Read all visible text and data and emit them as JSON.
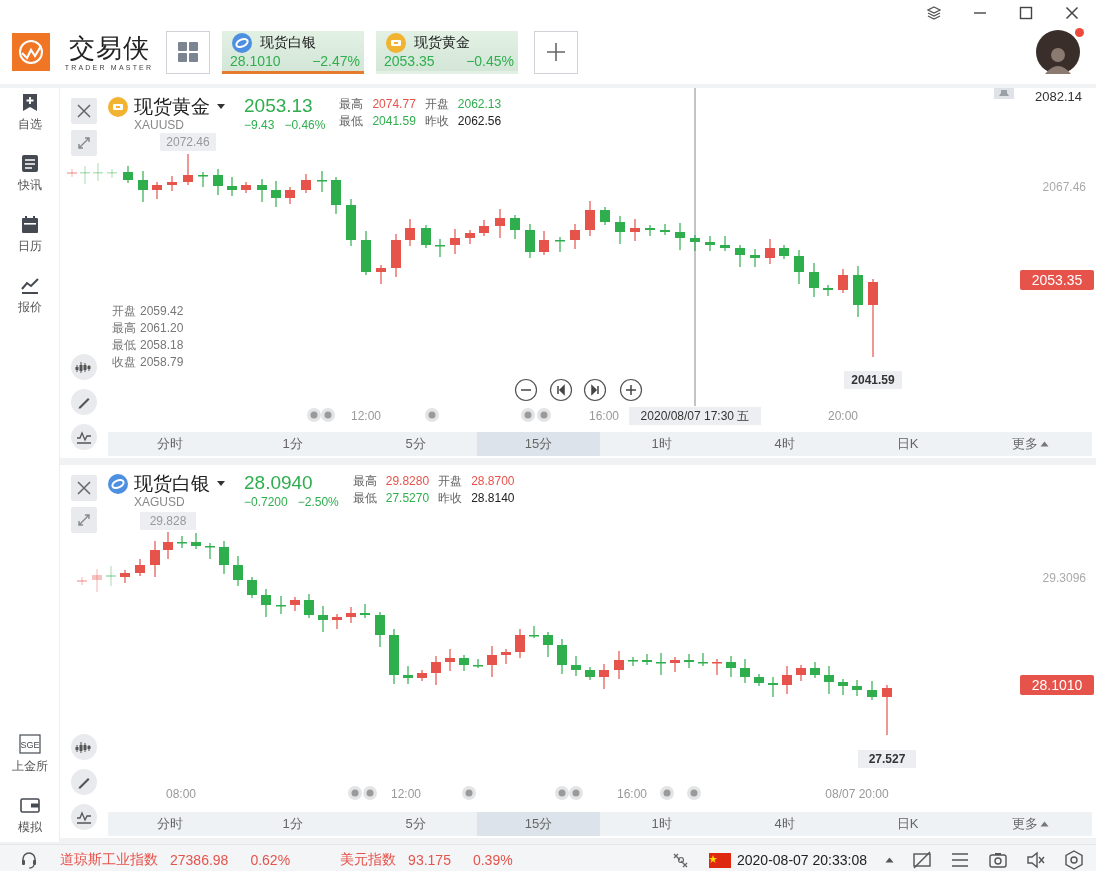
{
  "app": {
    "name": "交易侠",
    "tagline": "TRADER MASTER"
  },
  "quote_tabs": [
    {
      "kind": "silver",
      "name": "现货白银",
      "price": "28.1010",
      "change": "−2.47%",
      "selected": true
    },
    {
      "kind": "gold",
      "name": "现货黄金",
      "price": "2053.35",
      "change": "−0.45%",
      "selected": false
    }
  ],
  "avatar": {
    "notification": true
  },
  "sidebar": {
    "items": [
      {
        "label": "自选"
      },
      {
        "label": "快讯"
      },
      {
        "label": "日历"
      },
      {
        "label": "报价"
      }
    ],
    "bottom_items": [
      {
        "label": "上金所",
        "icon_text": "SGE"
      },
      {
        "label": "模拟"
      }
    ]
  },
  "charts": [
    {
      "kind": "gold",
      "name": "现货黄金",
      "symbol": "XAUUSD",
      "price": "2053.13",
      "color": "#2fae4e",
      "change": "−9.43",
      "change_pct": "−0.46%",
      "stats": [
        {
          "label": "最高",
          "value": "2074.77",
          "color": "#e5534b"
        },
        {
          "label": "开盘",
          "value": "2062.13",
          "color": "#2fae4e"
        },
        {
          "label": "最低",
          "value": "2041.59",
          "color": "#2fae4e"
        },
        {
          "label": "昨收",
          "value": "2062.56",
          "color": "#222222"
        }
      ],
      "top_label": "2082.14",
      "axis_labels": [
        "2067.46"
      ],
      "last_price": "2053.35",
      "high_marker": "2072.46",
      "low_marker": "2041.59",
      "ohlc_info": [
        {
          "label": "开盘",
          "value": "2059.42"
        },
        {
          "label": "最高",
          "value": "2061.20"
        },
        {
          "label": "最低",
          "value": "2058.18"
        },
        {
          "label": "收盘",
          "value": "2058.79"
        }
      ],
      "time_labels": [
        "12:00",
        "16:00",
        "20:00"
      ],
      "crosshair": "2020/08/07 17:30 五",
      "zoom_controls": true,
      "periods": [
        {
          "label": "分时",
          "selected": false
        },
        {
          "label": "1分",
          "selected": false
        },
        {
          "label": "5分",
          "selected": false
        },
        {
          "label": "15分",
          "selected": true
        },
        {
          "label": "1时",
          "selected": false
        },
        {
          "label": "4时",
          "selected": false
        },
        {
          "label": "日K",
          "selected": false
        }
      ],
      "more": "更多"
    },
    {
      "kind": "silver",
      "name": "现货白银",
      "symbol": "XAGUSD",
      "price": "28.0940",
      "color": "#2fae4e",
      "change": "−0.7200",
      "change_pct": "−2.50%",
      "stats": [
        {
          "label": "最高",
          "value": "29.8280",
          "color": "#e5534b"
        },
        {
          "label": "开盘",
          "value": "28.8700",
          "color": "#e5534b"
        },
        {
          "label": "最低",
          "value": "27.5270",
          "color": "#2fae4e"
        },
        {
          "label": "昨收",
          "value": "28.8140",
          "color": "#222222"
        }
      ],
      "axis_labels": [
        "29.3096"
      ],
      "last_price": "28.1010",
      "high_marker": "29.828",
      "low_marker": "27.527",
      "time_labels": [
        "08:00",
        "12:00",
        "16:00",
        "08/07 20:00"
      ],
      "periods": [
        {
          "label": "分时",
          "selected": false
        },
        {
          "label": "1分",
          "selected": false
        },
        {
          "label": "5分",
          "selected": false
        },
        {
          "label": "15分",
          "selected": true
        },
        {
          "label": "1时",
          "selected": false
        },
        {
          "label": "4时",
          "selected": false
        },
        {
          "label": "日K",
          "selected": false
        }
      ],
      "more": "更多"
    }
  ],
  "status_bar": {
    "indices": [
      {
        "name": "道琼斯工业指数",
        "value": "27386.98",
        "change": "0.62%"
      },
      {
        "name": "美元指数",
        "value": "93.175",
        "change": "0.39%"
      }
    ],
    "datetime": "2020-08-07 20:33:08"
  }
}
